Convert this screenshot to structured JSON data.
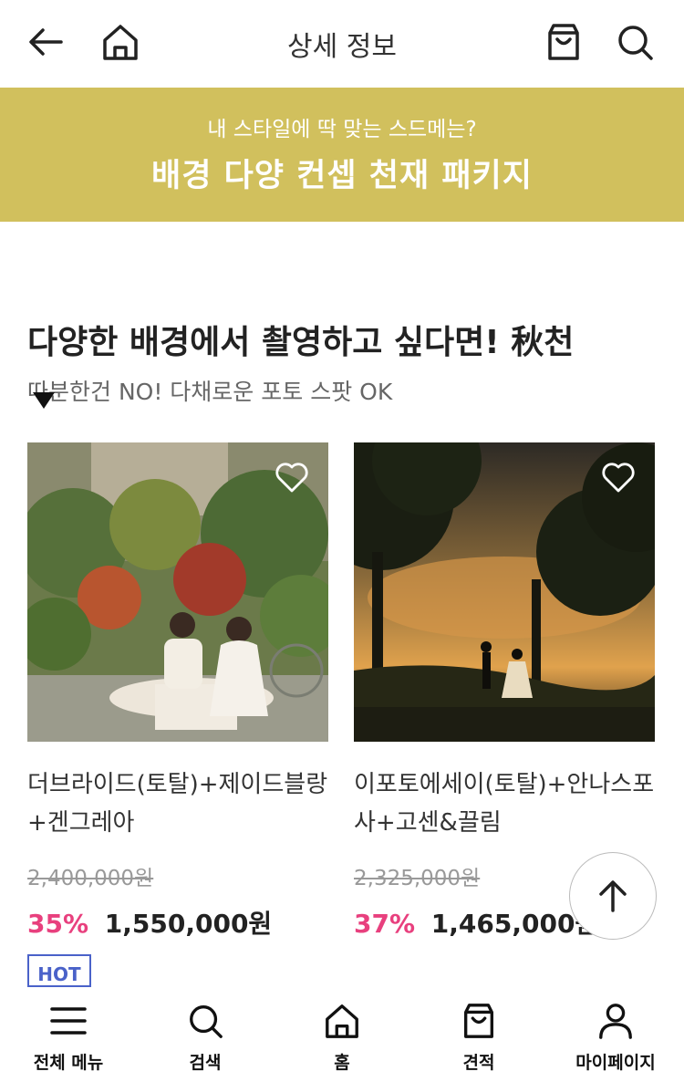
{
  "header": {
    "title": "상세 정보",
    "back_icon": "arrow-left-icon",
    "home_icon": "home-icon",
    "cart_icon": "shopping-bag-icon",
    "search_icon": "search-icon"
  },
  "banner": {
    "subtitle": "내 스타일에 딱 맞는 스드메는?",
    "title": "배경 다양 컨셉 천재 패키지",
    "color": "#d1c05d"
  },
  "section": {
    "title": "다양한 배경에서 촬영하고 싶다면! 秋천",
    "subtitle": "따분한건 NO! 다채로운 포토 스팟 OK"
  },
  "products": [
    {
      "name": "더브라이드(토탈)+제이드블랑+겐그레아",
      "original_price": "2,400,000원",
      "discount": "35%",
      "price": "1,550,000원",
      "image": "wedding-garden-photo"
    },
    {
      "name": "이포토에세이(토탈)+안나스포사+고센&끌림",
      "original_price": "2,325,000원",
      "discount": "37%",
      "price": "1,465,000원",
      "image": "wedding-sunset-photo"
    }
  ],
  "badge": {
    "hot": "HOT"
  },
  "bottom_nav": [
    {
      "label": "전체 메뉴",
      "icon": "menu-icon"
    },
    {
      "label": "검색",
      "icon": "search-icon"
    },
    {
      "label": "홈",
      "icon": "home-icon"
    },
    {
      "label": "견적",
      "icon": "shopping-bag-icon"
    },
    {
      "label": "마이페이지",
      "icon": "user-icon"
    }
  ],
  "colors": {
    "accent": "#e8407e",
    "hot_badge": "#4a62c9"
  }
}
